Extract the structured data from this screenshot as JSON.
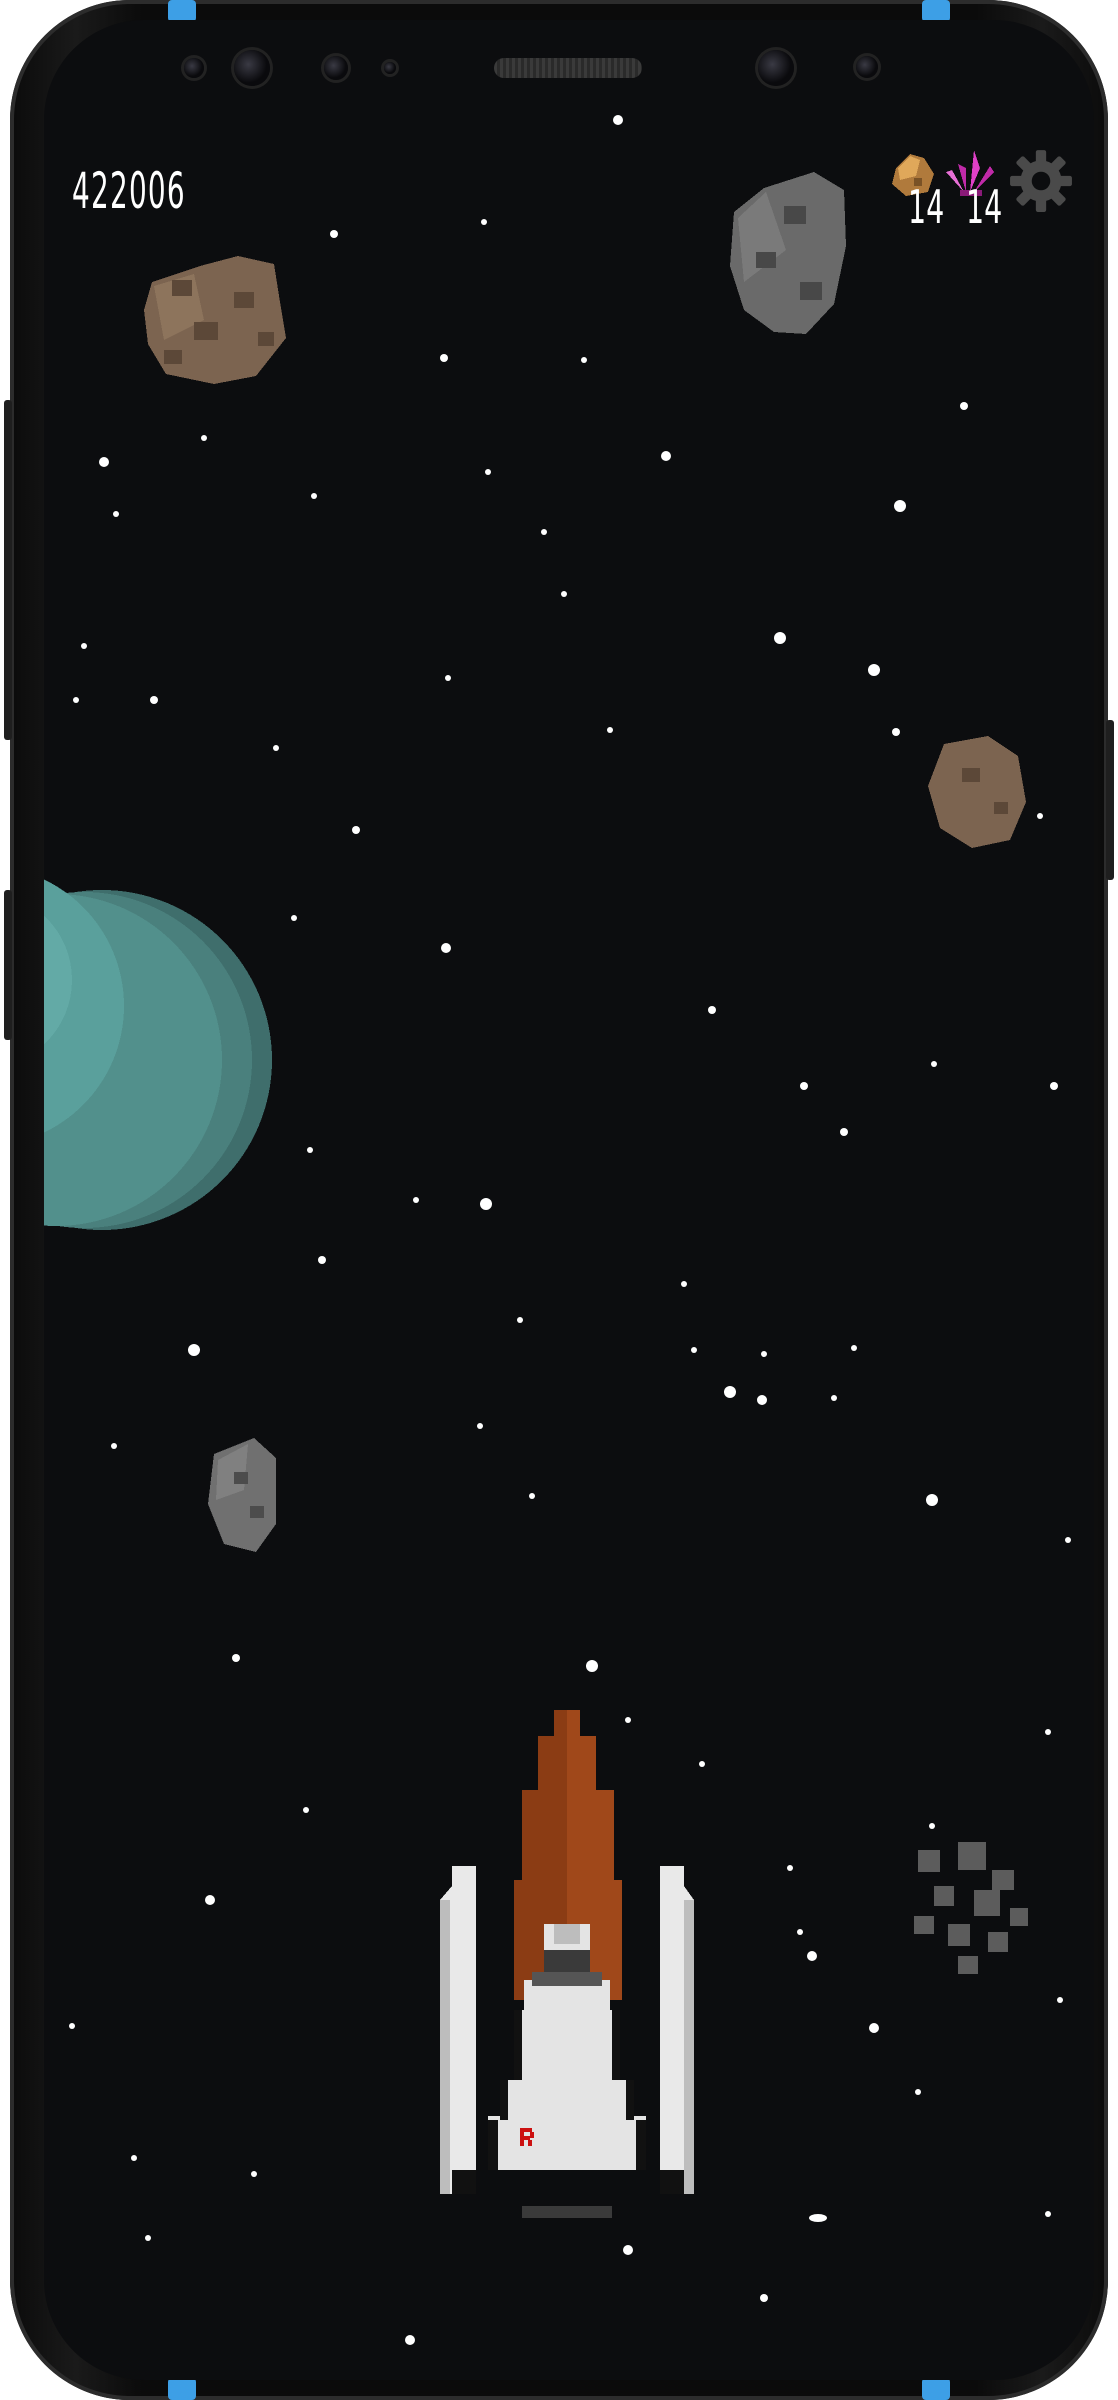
{
  "hud": {
    "score": "422006",
    "ore_count": "14",
    "crystal_count": "14",
    "ore_icon": "ore-chunk-icon",
    "crystal_icon": "pink-crystal-icon",
    "settings_icon": "gear-icon"
  },
  "colors": {
    "space_background": "#0c0d0f",
    "phone_accent": "#3d9fe6",
    "planet": "#4e8a87",
    "asteroid_brown": "#7c6450",
    "asteroid_gray": "#6a6a6a",
    "ship_white": "#e9e9e9",
    "ship_nose": "#8b3c14",
    "crystal": "#e040c8"
  },
  "ship": {
    "emblem": "R"
  }
}
